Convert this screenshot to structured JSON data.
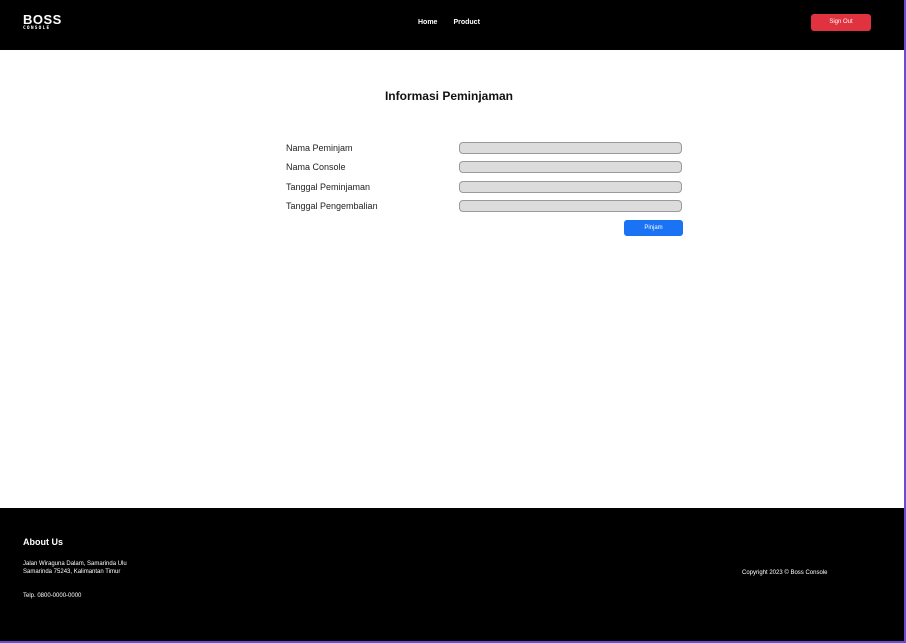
{
  "header": {
    "logo_main": "BOSS",
    "logo_sub": "CONSOLE",
    "nav": [
      {
        "label": "Home"
      },
      {
        "label": "Product"
      }
    ],
    "signout_label": "Sign Out"
  },
  "main": {
    "title": "Informasi Peminjaman",
    "fields": [
      {
        "label": "Nama Peminjam",
        "value": ""
      },
      {
        "label": "Nama Console",
        "value": ""
      },
      {
        "label": "Tanggal Peminjaman",
        "value": ""
      },
      {
        "label": "Tanggal Pengembalian",
        "value": ""
      }
    ],
    "submit_label": "Pinjam"
  },
  "footer": {
    "about_title": "About Us",
    "address_line1": "Jalan Wiraguna Dalam, Samarinda Ulu",
    "address_line2": "Samarinda 75243, Kalimantan Timur",
    "phone": "Telp. 0800-0000-0000",
    "copyright": "Copyright 2023 © Boss Console"
  },
  "colors": {
    "header_bg": "#000000",
    "footer_bg": "#000000",
    "signout_bg": "#e0323f",
    "submit_bg": "#1a72f5",
    "input_bg": "#dcdcdc"
  }
}
